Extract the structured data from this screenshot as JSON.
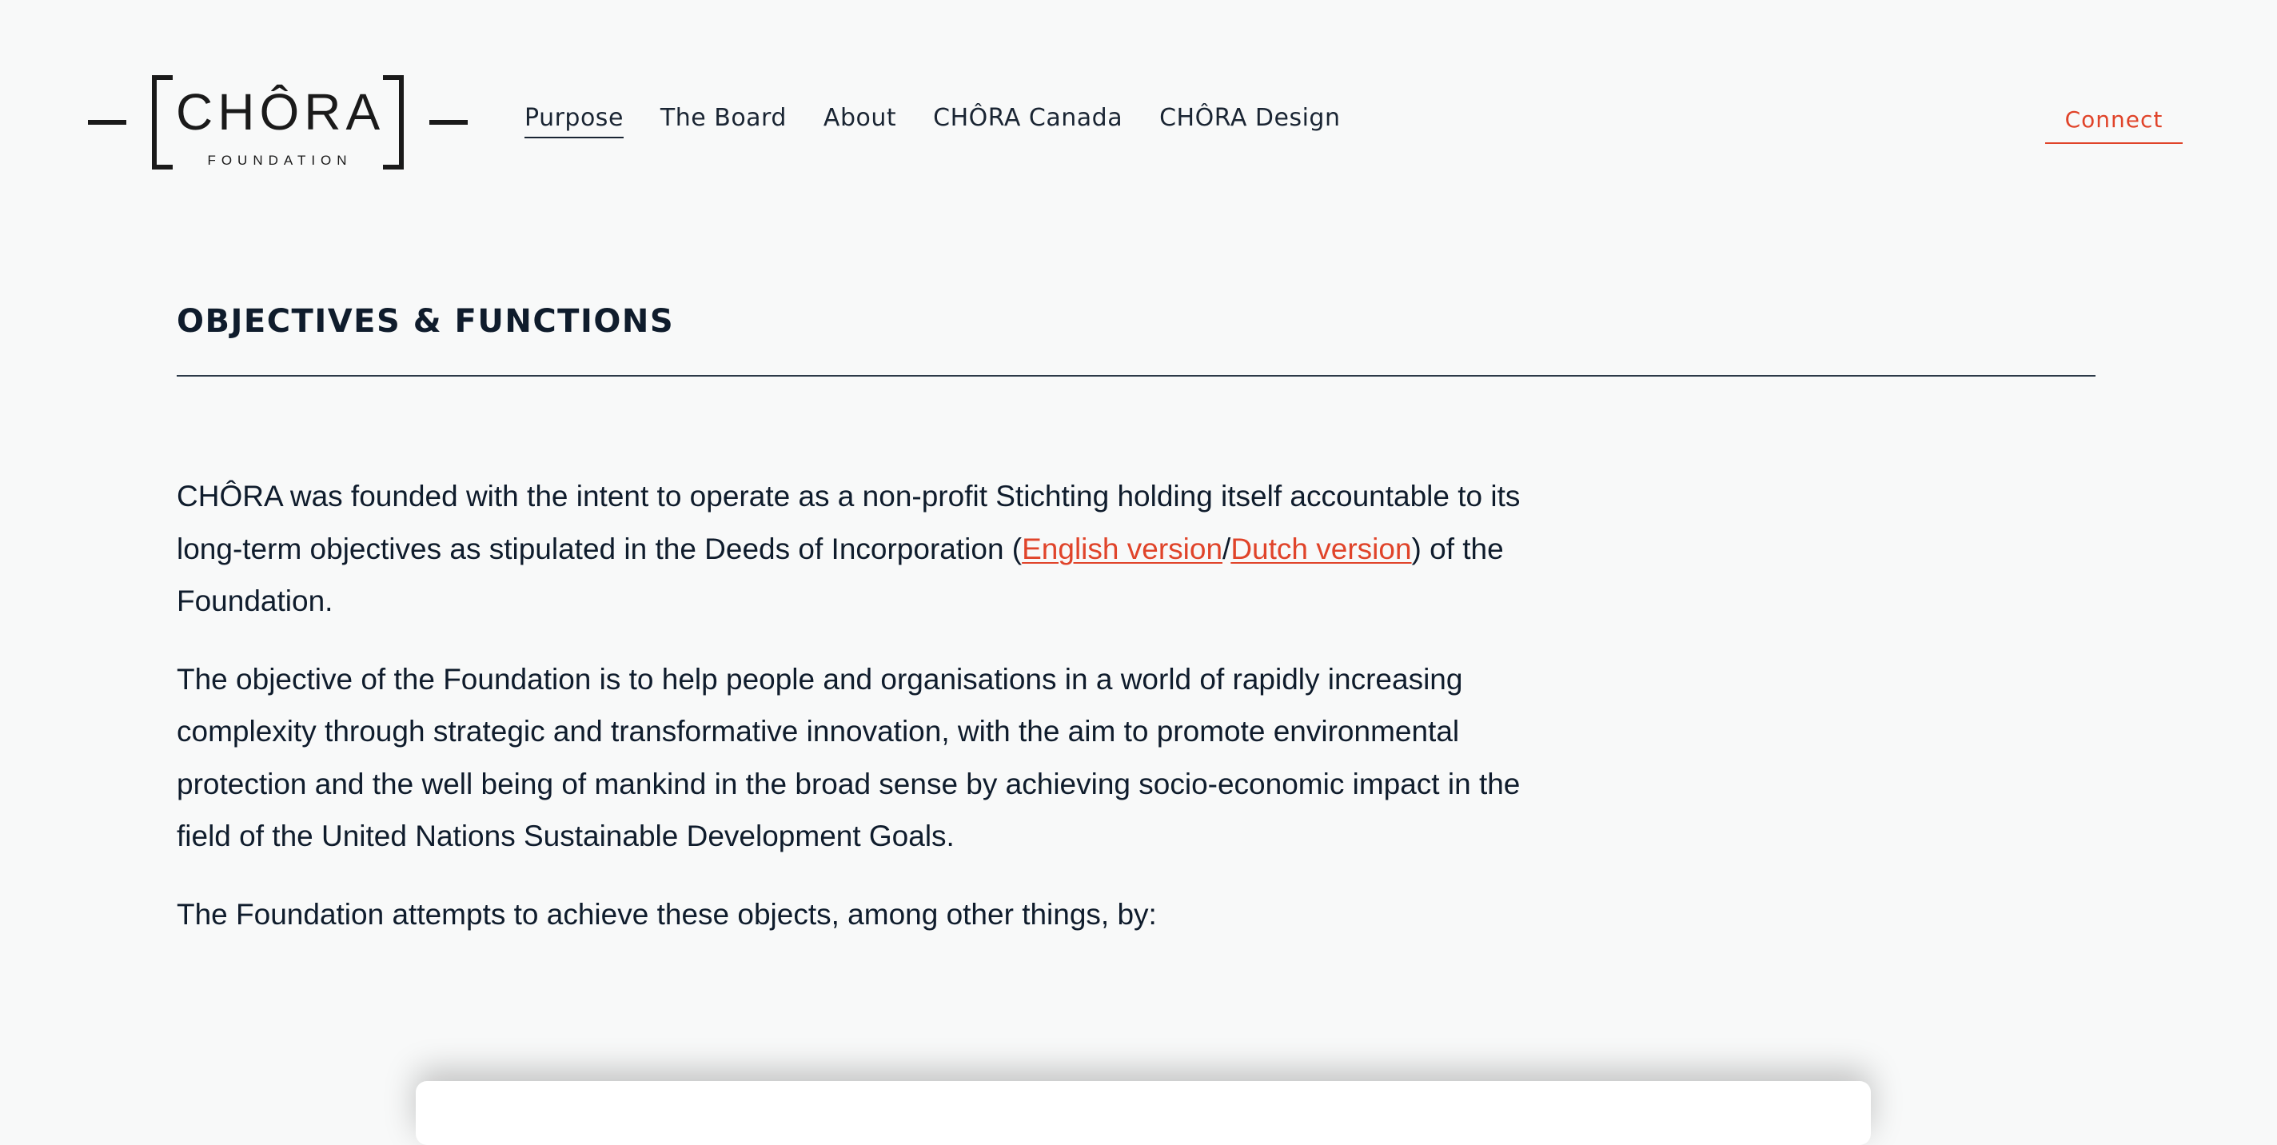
{
  "logo": {
    "wordmark": "CHÔRA",
    "subtitle": "FOUNDATION"
  },
  "nav": {
    "items": [
      {
        "label": "Purpose"
      },
      {
        "label": "The Board"
      },
      {
        "label": "About"
      },
      {
        "label": "CHÔRA Canada"
      },
      {
        "label": "CHÔRA Design"
      }
    ],
    "active": "Purpose"
  },
  "header": {
    "connect_label": "Connect"
  },
  "section": {
    "title": "OBJECTIVES & FUNCTIONS"
  },
  "content": {
    "p1": {
      "before": "CHÔRA was founded with the intent to operate as a non-profit Stichting holding itself accountable to its long-term objectives as stipulated in the Deeds of Incorporation (",
      "link_english": "English version",
      "separator": "/",
      "link_dutch": "Dutch version",
      "after": ") of the Foundation."
    },
    "p2": "The objective of the Foundation is to help people and organisations in a world of rapidly increasing complexity through strategic and transformative innovation, with the aim to promote environmental protection and the well being of mankind in the broad sense by achieving socio-economic impact in the field of the United Nations Sustainable Development Goals.",
    "p3": "The Foundation attempts to achieve these objects, among other things, by:"
  },
  "colors": {
    "background": "#f8f9f9",
    "text": "#0f1c2c",
    "accent": "#e0442a"
  }
}
